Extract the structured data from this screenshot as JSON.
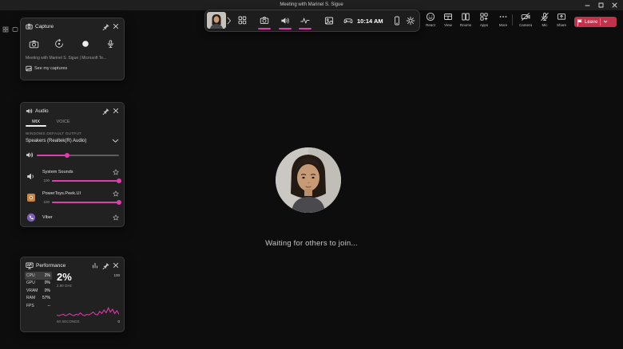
{
  "colors": {
    "accent": "#e23caf",
    "leave_red": "#c4314b"
  },
  "titlebar": {
    "title": "Meeting with Marinel S. Sigue"
  },
  "gamebar_toolbar": {
    "time": "10:14 AM"
  },
  "teams_toolbar": {
    "items": [
      {
        "label": "React"
      },
      {
        "label": "View"
      },
      {
        "label": "Rooms"
      },
      {
        "label": "Apps"
      },
      {
        "label": "More"
      },
      {
        "label": "Camera"
      },
      {
        "label": "Mic"
      },
      {
        "label": "Share"
      }
    ],
    "leave": {
      "label": "Leave"
    }
  },
  "stage": {
    "waiting_text": "Waiting for others to join..."
  },
  "capture_panel": {
    "title": "Capture",
    "source_text": "Meeting with Marinel S. Sigue | Microsoft Te...",
    "see_captures_label": "See my captures"
  },
  "audio_panel": {
    "title": "Audio",
    "tabs": {
      "mix": "MIX",
      "voice": "VOICE"
    },
    "section_label": "WINDOWS DEFAULT OUTPUT",
    "device_name": "Speakers (Realtek(R) Audio)",
    "master_volume_percent": 37,
    "apps": [
      {
        "name": "System Sounds",
        "volume": 100
      },
      {
        "name": "PowerToys.Peek.UI",
        "volume": 100
      },
      {
        "name": "Viber"
      }
    ]
  },
  "performance_panel": {
    "title": "Performance",
    "stats": [
      {
        "label": "CPU",
        "value": "2%",
        "selected": true
      },
      {
        "label": "GPU",
        "value": "0%"
      },
      {
        "label": "VRAM",
        "value": "0%"
      },
      {
        "label": "RAM",
        "value": "57%"
      },
      {
        "label": "FPS",
        "value": "--"
      }
    ],
    "selected_value_big": "2%",
    "selected_clock": "2.80 GHz",
    "graph": {
      "y_max": "100",
      "y_min": "0",
      "x_label": "60 SECONDS",
      "points": [
        3,
        2,
        3,
        4,
        2,
        3,
        5,
        3,
        2,
        4,
        3,
        6,
        3,
        2,
        4,
        3,
        5,
        7,
        4,
        3,
        8,
        5,
        10,
        6,
        13,
        7,
        11,
        5,
        9,
        4
      ]
    }
  }
}
